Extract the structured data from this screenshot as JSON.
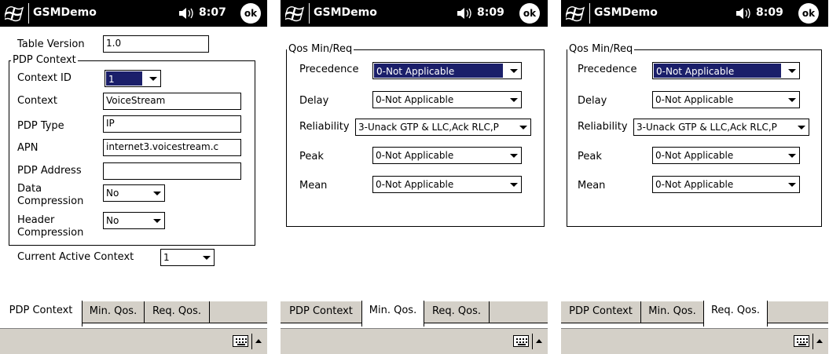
{
  "app_title": "GSMDemo",
  "ok_label": "ok",
  "screens": [
    {
      "clock": "8:07",
      "active_tab": "PDP Context"
    },
    {
      "clock": "8:09",
      "active_tab": "Min. Qos."
    },
    {
      "clock": "8:09",
      "active_tab": "Req. Qos."
    }
  ],
  "tabs": [
    "PDP Context",
    "Min. Qos.",
    "Req. Qos."
  ],
  "pdp": {
    "table_version_label": "Table Version",
    "table_version_value": "1.0",
    "group_label": "PDP Context",
    "context_id_label": "Context ID",
    "context_id_value": "1",
    "context_label": "Context",
    "context_value": "VoiceStream",
    "pdp_type_label": "PDP Type",
    "pdp_type_value": "IP",
    "apn_label": "APN",
    "apn_value": "internet3.voicestream.c",
    "pdp_address_label": "PDP Address",
    "pdp_address_value": "",
    "data_compression_label_1": "Data",
    "data_compression_label_2": "Compression",
    "data_compression_value": "No",
    "header_compression_label_1": "Header",
    "header_compression_label_2": "Compression",
    "header_compression_value": "No",
    "current_active_label": "Current Active Context",
    "current_active_value": "1"
  },
  "qos": {
    "group_label": "Qos Min/Req",
    "precedence_label": "Precedence",
    "precedence_value": "0-Not Applicable",
    "delay_label": "Delay",
    "delay_value": "0-Not Applicable",
    "reliability_label": "Reliability",
    "reliability_value": "3-Unack GTP & LLC,Ack RLC,P",
    "peak_label": "Peak",
    "peak_value": "0-Not Applicable",
    "mean_label": "Mean",
    "mean_value": "0-Not Applicable"
  },
  "colors": {
    "titlebar": "#000000",
    "tab_bg": "#d4d0c8",
    "selection": "#1b1f6a"
  }
}
